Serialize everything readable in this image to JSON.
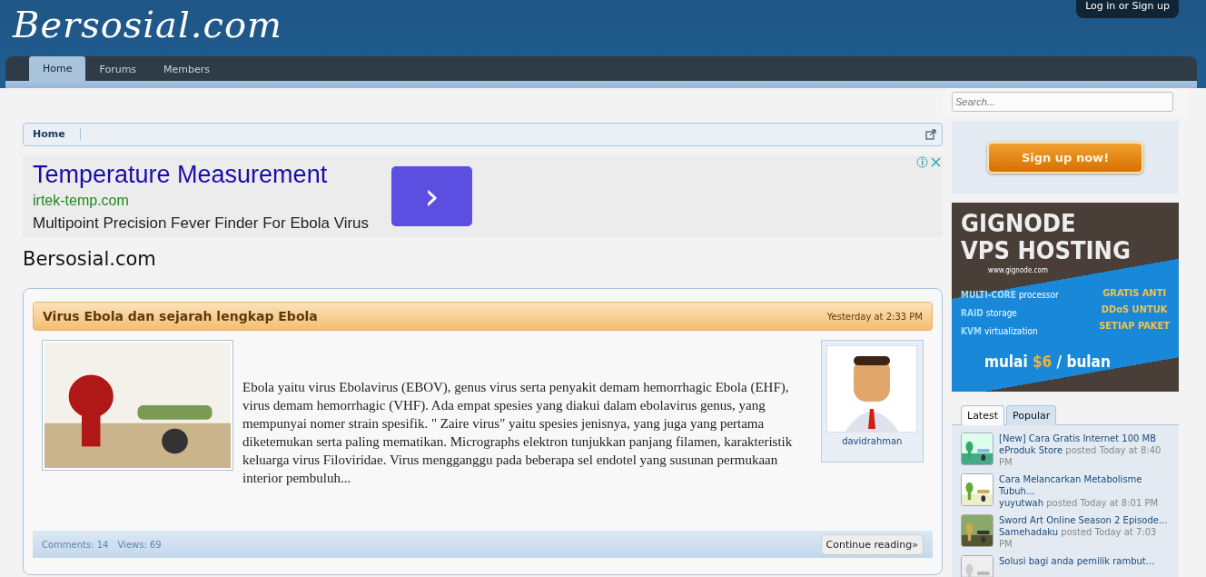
{
  "header": {
    "logo": "Bersosial.com",
    "login": "Log in or Sign up"
  },
  "nav": {
    "tabs": [
      {
        "label": "Home",
        "selected": true
      },
      {
        "label": "Forums",
        "selected": false
      },
      {
        "label": "Members",
        "selected": false
      }
    ]
  },
  "breadcrumb": {
    "items": [
      "Home"
    ]
  },
  "ad": {
    "title": "Temperature Measurement",
    "url": "irtek-temp.com",
    "description": "Multipoint Precision Fever Finder For Ebola Virus",
    "button": "›"
  },
  "page_title": "Bersosial.com",
  "post": {
    "title": "Virus Ebola dan sejarah lengkap Ebola",
    "date": "Yesterday at 2:33 PM",
    "body": "Ebola yaitu virus Ebolavirus (EBOV), genus virus serta penyakit demam hemorrhagic Ebola (EHF), virus demam hemorrhagic (VHF). Ada empat spesies yang diakui dalam ebolavirus genus, yang mempunyai nomer strain spesifik. \" Zaire virus\" yaitu spesies jenisnya, yang juga yang pertama diketemukan serta paling mematikan. Micrographs elektron tunjukkan panjang filamen, karakteristik keluarga virus Filoviridae. Virus mengganggu pada beberapa sel endotel yang susunan permukaan interior pembuluh...",
    "author": "davidrahman",
    "comments": "Comments: 14",
    "views": "Views: 69",
    "continue": "Continue reading»"
  },
  "sidebar": {
    "search": {
      "placeholder": "Search..."
    },
    "signup": "Sign up now!",
    "banner": {
      "line_1": "GIGNODE",
      "line_2": "VPS HOSTING",
      "site": "www.gignode.com",
      "features": [
        {
          "strong": "MULTI-CORE",
          "rest": "processor"
        },
        {
          "strong": "RAID",
          "rest": "storage"
        },
        {
          "strong": "KVM",
          "rest": "virtualization"
        }
      ],
      "offer": [
        "GRATIS ANTI",
        "DDoS UNTUK",
        "SETIAP PAKET"
      ],
      "price_pre": "mulai",
      "price": "$6",
      "price_post": "/ bulan"
    },
    "tabs": [
      {
        "label": "Latest",
        "selected": true
      },
      {
        "label": "Popular",
        "selected": false
      }
    ],
    "items": [
      {
        "title": "[New] Cara Gratis Internet 100 MB",
        "author": "eProduk Store",
        "meta": "posted Today at 8:40 PM"
      },
      {
        "title": "Cara Melancarkan Metabolisme Tubuh...",
        "author": "yuyutwah",
        "meta": "posted Today at 8:01 PM"
      },
      {
        "title": "Sword Art Online Season 2 Episode...",
        "author": "Samehadaku",
        "meta": "posted Today at 7:03 PM"
      },
      {
        "title": "Solusi bagi anda pemilik rambut..."
      }
    ]
  }
}
